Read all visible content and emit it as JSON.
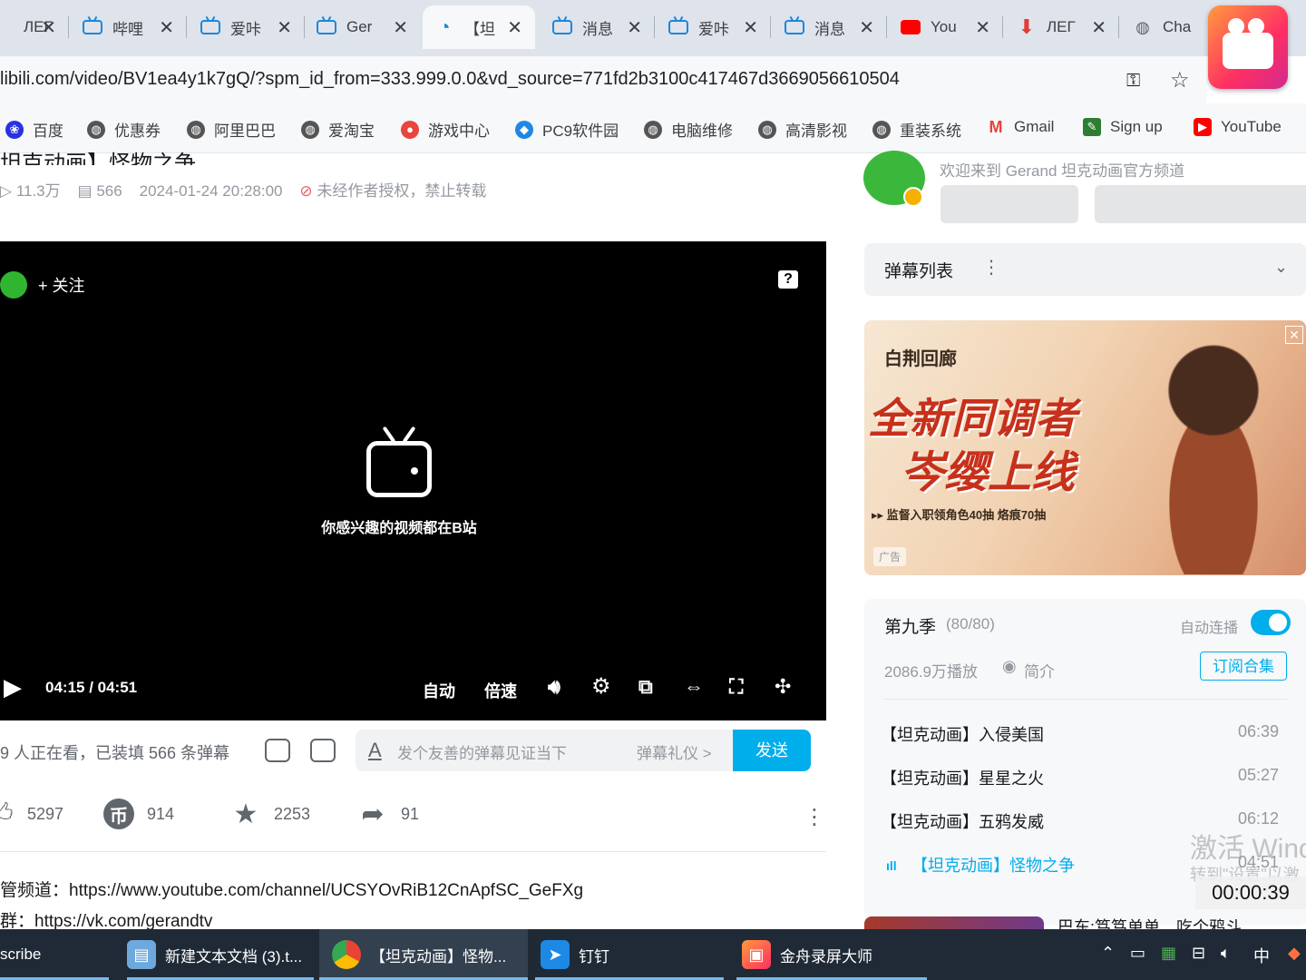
{
  "tabs": [
    {
      "label": "ЛЕГ",
      "icon": "mars-icon"
    },
    {
      "label": "哔哩",
      "icon": "bilibili-tv-icon"
    },
    {
      "label": "爱咔",
      "icon": "bilibili-tv-icon"
    },
    {
      "label": "Ger",
      "icon": "bilibili-tv-icon"
    },
    {
      "label": "【坦",
      "icon": "bilibili-loading-icon",
      "active": true
    },
    {
      "label": "消息",
      "icon": "bilibili-tv-icon"
    },
    {
      "label": "爱咔",
      "icon": "bilibili-tv-icon"
    },
    {
      "label": "消息",
      "icon": "bilibili-tv-icon"
    },
    {
      "label": "You",
      "icon": "youtube-icon"
    },
    {
      "label": "ЛЕГ",
      "icon": "download-icon"
    },
    {
      "label": "Cha",
      "icon": "globe-icon"
    }
  ],
  "address": {
    "url": "libili.com/video/BV1ea4y1k7gQ/?spm_id_from=333.999.0.0&vd_source=771fd2b3100c417467d3669056610504"
  },
  "bookmarks": [
    {
      "label": "百度",
      "color": "#2932e1"
    },
    {
      "label": "优惠券",
      "color": "#555555"
    },
    {
      "label": "阿里巴巴",
      "color": "#555555"
    },
    {
      "label": "爱淘宝",
      "color": "#555555"
    },
    {
      "label": "游戏中心",
      "color": "#e8463c"
    },
    {
      "label": "PC9软件园",
      "color": "#1e88e5"
    },
    {
      "label": "电脑维修",
      "color": "#555555"
    },
    {
      "label": "高清影视",
      "color": "#555555"
    },
    {
      "label": "重装系统",
      "color": "#555555"
    },
    {
      "label": "Gmail",
      "color": "#ea4335"
    },
    {
      "label": "Sign up",
      "color": "#2e7d32"
    },
    {
      "label": "YouTube",
      "color": "#ff0000"
    }
  ],
  "video": {
    "title": "坦克动画】怪物之争",
    "views": "11.3万",
    "danmaku_count": "566",
    "date": "2024-01-24 20:28:00",
    "copyright": "未经作者授权，禁止转载"
  },
  "player": {
    "follow": "+ 关注",
    "slogan": "你感兴趣的视频都在B站",
    "time": "04:15 / 04:51",
    "auto": "自动",
    "speed": "倍速"
  },
  "danmaku": {
    "viewers": "9 人正在看，已装填 566 条弹幕",
    "placeholder": "发个友善的弹幕见证当下",
    "etiquette": "弹幕礼仪 >",
    "send": "发送"
  },
  "actions": {
    "like": "5297",
    "coin": "914",
    "fav": "2253",
    "share": "91"
  },
  "desc": {
    "line1": "管频道：https://www.youtube.com/channel/UCSYOvRiB12CnApfSC_GeFXg",
    "line2": "群：https://vk.com/gerandtv"
  },
  "up": {
    "welcome": "欢迎来到 Gerand 坦克动画官方频道"
  },
  "dm_list": {
    "title": "弹幕列表",
    "kebab": "⋮",
    "chevron": "⌄"
  },
  "ad": {
    "brand": "白荆回廊",
    "headline1": "全新同调者",
    "headline2": "岑缨上线",
    "sub": "▸▸ 监督入职领角色40抽 烙痕70抽",
    "tag": "广告"
  },
  "playlist": {
    "title": "第九季",
    "count": "(80/80)",
    "autoplay": "自动连播",
    "plays": "2086.9万播放",
    "intro": "简介",
    "subscribe": "订阅合集",
    "episodes": [
      {
        "title": "【坦克动画】入侵美国",
        "duration": "06:39"
      },
      {
        "title": "【坦克动画】星星之火",
        "duration": "05:27"
      },
      {
        "title": "【坦克动画】五鸦发威",
        "duration": "06:12"
      },
      {
        "title": "【坦克动画】怪物之争",
        "duration": "04:51",
        "current": true
      }
    ],
    "next_title": "巴东:笃笃单单，吃个鸦斗"
  },
  "watermark": {
    "line1": "激活 Wind",
    "line2": "转到\"设置\"以激"
  },
  "recorder": {
    "time": "00:00:39"
  },
  "taskbar": {
    "items": [
      {
        "label": "scribe"
      },
      {
        "label": "新建文本文档 (3).t..."
      },
      {
        "label": "【坦克动画】怪物..."
      },
      {
        "label": "钉钉"
      },
      {
        "label": "金舟录屏大师"
      }
    ],
    "ime": "中"
  },
  "colors": {
    "accent": "#00aeec",
    "player_bg": "#000000"
  }
}
